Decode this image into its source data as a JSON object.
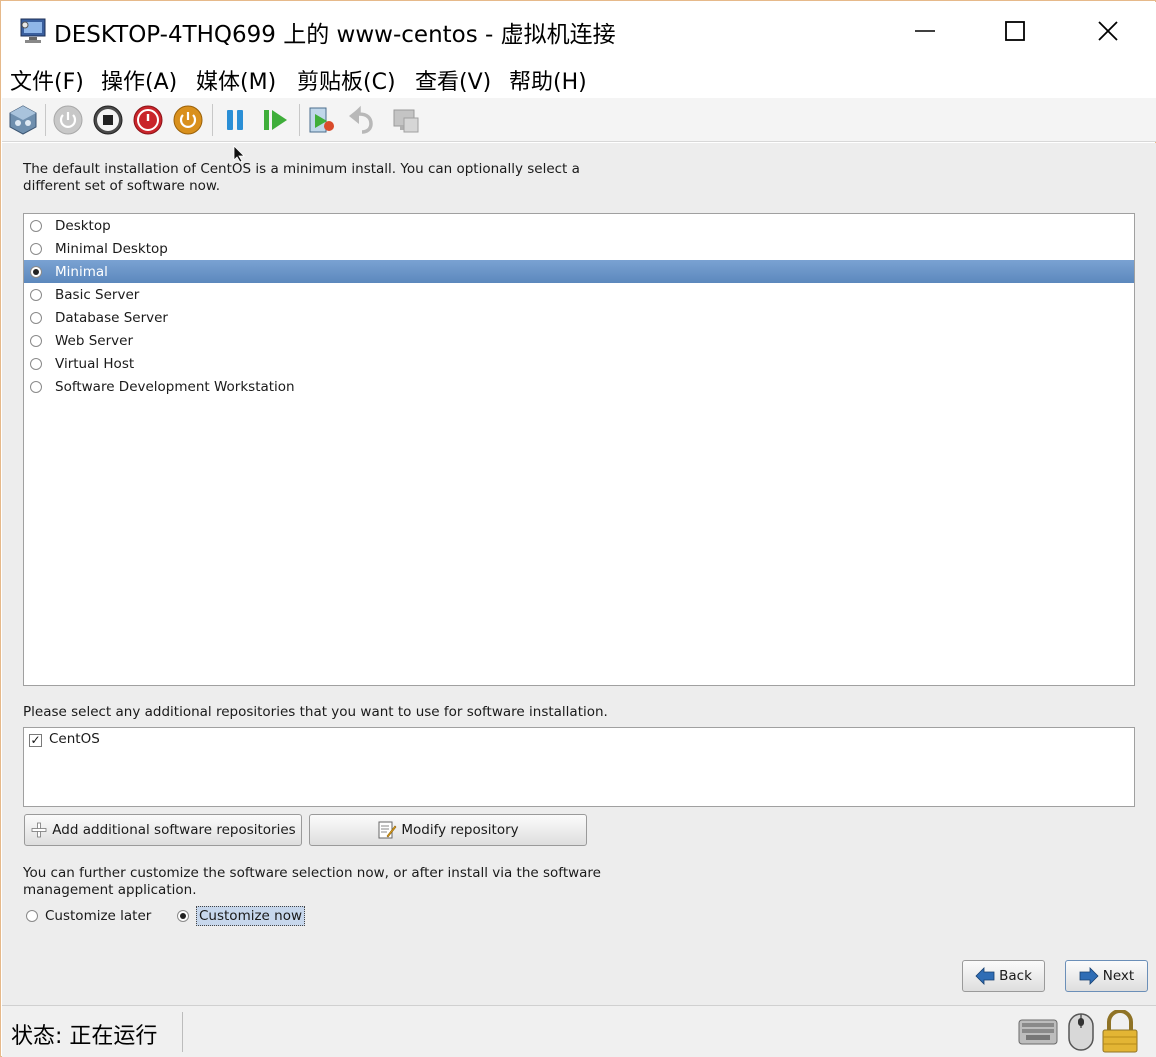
{
  "window": {
    "title": "DESKTOP-4THQ699 上的 www-centos - 虚拟机连接",
    "controls": {
      "minimize": "—",
      "maximize": "☐",
      "close": "✕"
    }
  },
  "menu": {
    "items": [
      "文件(F)",
      "操作(A)",
      "媒体(M)",
      "剪贴板(C)",
      "查看(V)",
      "帮助(H)"
    ]
  },
  "toolbar": {
    "buttons": [
      "ctrl-alt-del",
      "start",
      "turn-off",
      "shut-down",
      "save",
      "pause",
      "resume",
      "checkpoint",
      "revert",
      "enhanced-session"
    ]
  },
  "installer": {
    "intro": "The default installation of CentOS is a minimum install. You can optionally select a different set of software now.",
    "options": [
      {
        "label": "Desktop",
        "selected": false
      },
      {
        "label": "Minimal Desktop",
        "selected": false
      },
      {
        "label": "Minimal",
        "selected": true
      },
      {
        "label": "Basic Server",
        "selected": false
      },
      {
        "label": "Database Server",
        "selected": false
      },
      {
        "label": "Web Server",
        "selected": false
      },
      {
        "label": "Virtual Host",
        "selected": false
      },
      {
        "label": "Software Development Workstation",
        "selected": false
      }
    ],
    "repo_prompt": "Please select any additional repositories that you want to use for software installation.",
    "repos": [
      {
        "label": "CentOS",
        "checked": true
      }
    ],
    "add_repo_label": "Add additional software repositories",
    "modify_repo_label": "Modify repository",
    "customize_text": "You can further customize the software selection now, or after install via the software management application.",
    "customize_later_label": "Customize later",
    "customize_now_label": "Customize now",
    "customize_selection": "now",
    "back_label": "Back",
    "next_label": "Next"
  },
  "status": {
    "text": "状态: 正在运行"
  },
  "colors": {
    "selection": "#6c95c8",
    "frame_border": "#e6b98a",
    "installer_bg": "#ededed"
  }
}
